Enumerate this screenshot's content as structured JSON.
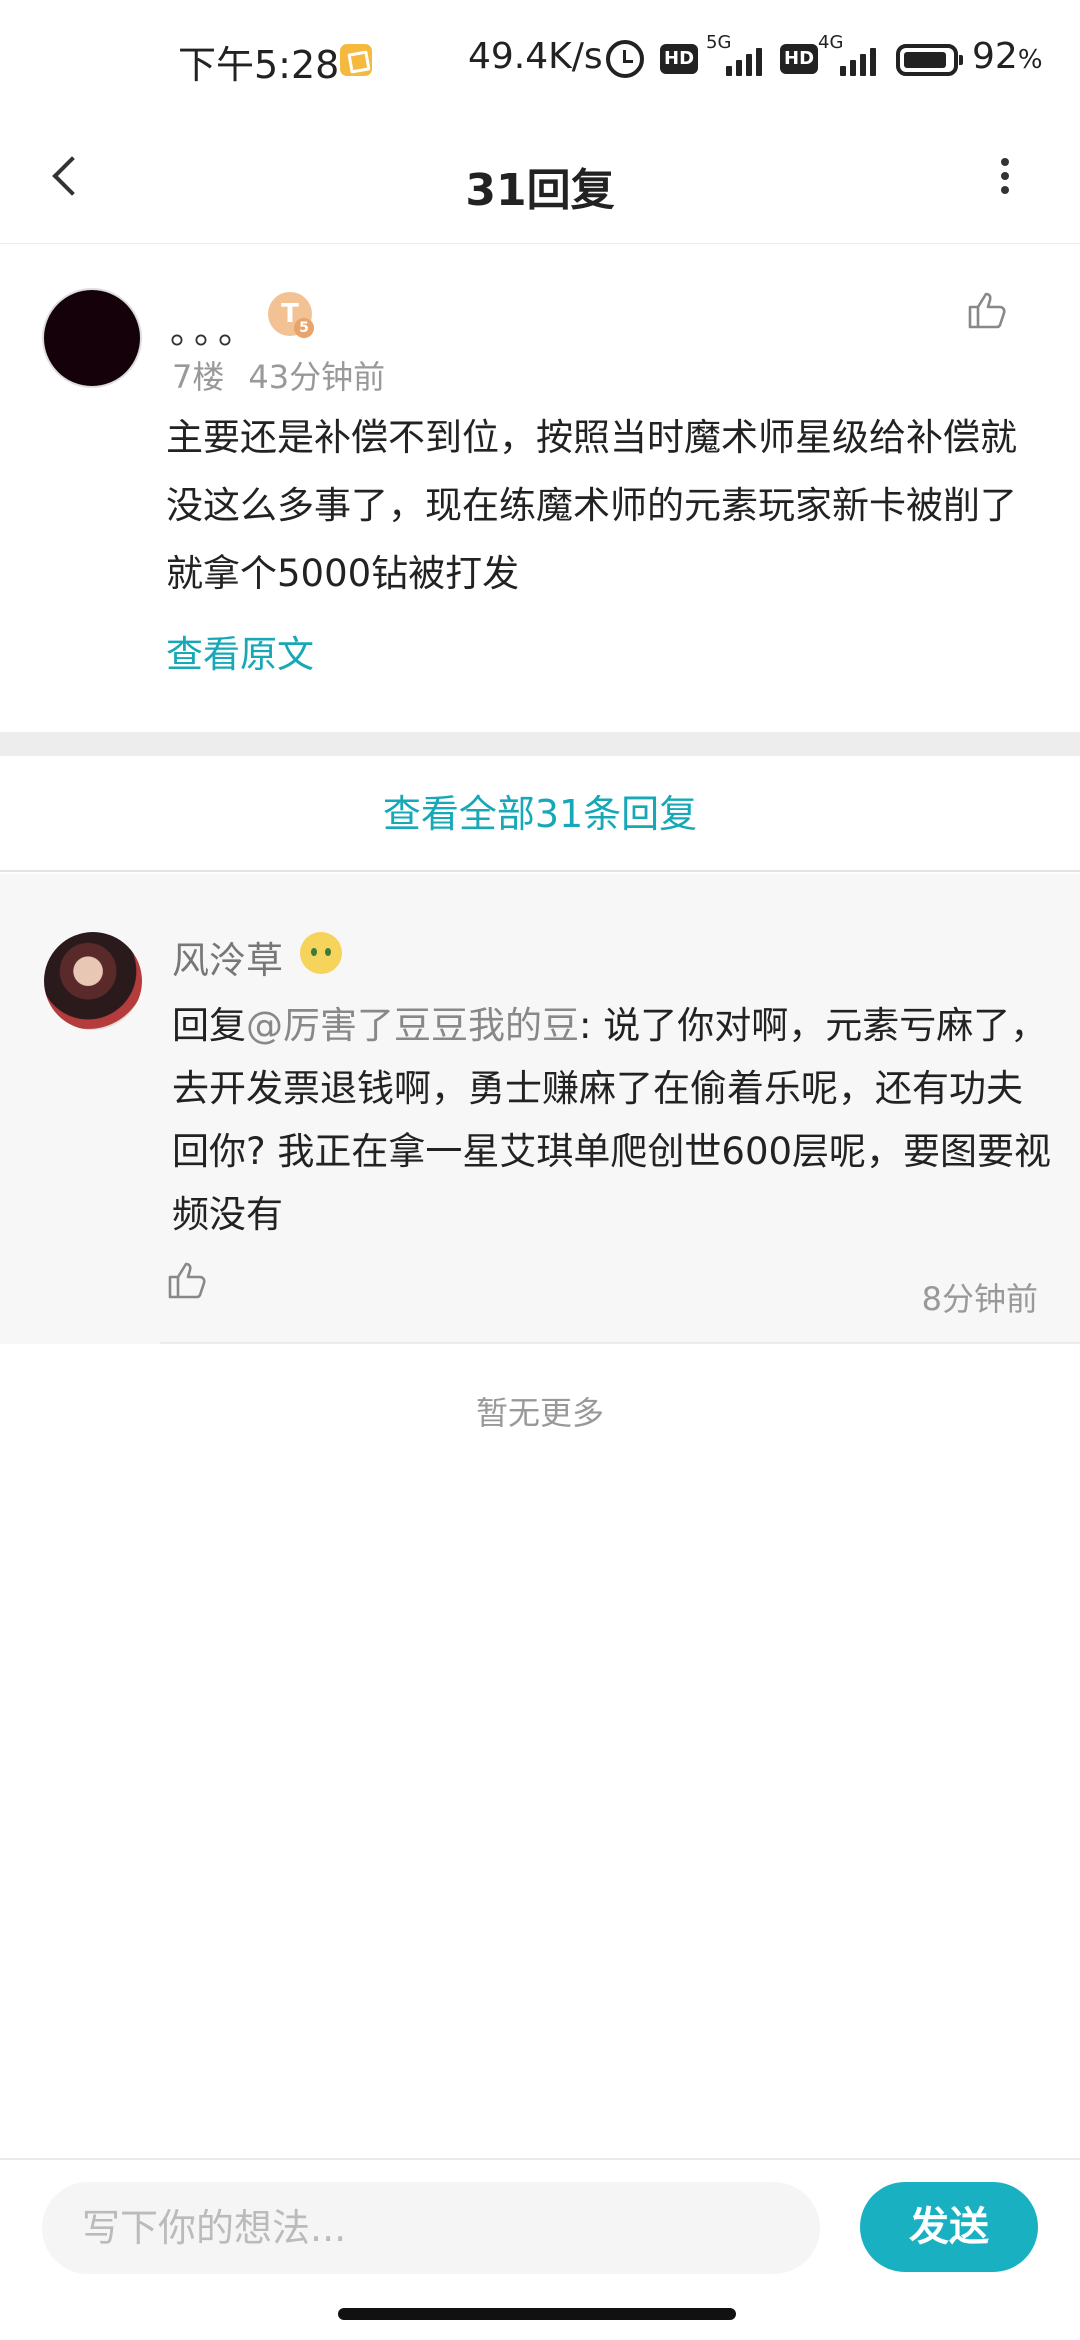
{
  "status_bar": {
    "time": "下午5:28",
    "network_speed": "49.4K/s",
    "hd_label": "HD",
    "net_5g": "5G",
    "net_4g": "4G",
    "battery_percent": "92",
    "battery_unit": "%",
    "battery_level": 0.92
  },
  "header": {
    "title": "31回复"
  },
  "main_comment": {
    "username": "。。。",
    "level_badge": "T",
    "level_number": "5",
    "floor": "7楼",
    "time": "43分钟前",
    "text": "主要还是补偿不到位，按照当时魔术师星级给补偿就没这么多事了，现在练魔术师的元素玩家新卡被削了就拿个5000钻被打发",
    "view_original": "查看原文"
  },
  "view_all_label": "查看全部31条回复",
  "reply": {
    "username": "风泠草",
    "prefix": "回复",
    "mention": "@厉害了豆豆我的豆",
    "text": ": 说了你对啊，元素亏麻了，去开发票退钱啊，勇士赚麻了在偷着乐呢，还有功夫回你? 我正在拿一星艾琪单爬创世600层呢，要图要视频没有",
    "time": "8分钟前"
  },
  "no_more_label": "暂无更多",
  "composer": {
    "placeholder": "写下你的想法...",
    "send_label": "发送"
  },
  "colors": {
    "accent": "#17a8b8",
    "send_button": "#19b0c1"
  }
}
